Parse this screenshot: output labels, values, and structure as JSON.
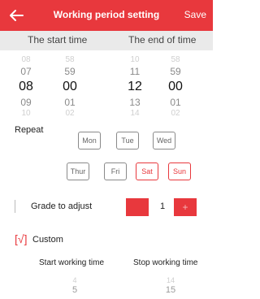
{
  "header": {
    "title": "Working period setting",
    "save_label": "Save"
  },
  "tabs": {
    "start_label": "The start time",
    "end_label": "The end of time"
  },
  "start_time": {
    "hours": [
      "08",
      "07",
      "08",
      "09",
      "10"
    ],
    "minutes": [
      "58",
      "59",
      "00",
      "01",
      "02"
    ]
  },
  "end_time": {
    "hours": [
      "10",
      "11",
      "12",
      "13",
      "14"
    ],
    "minutes": [
      "58",
      "59",
      "00",
      "01",
      "02"
    ]
  },
  "repeat": {
    "label": "Repeat",
    "days": [
      {
        "label": "Mon",
        "selected": false
      },
      {
        "label": "Tue",
        "selected": false
      },
      {
        "label": "Wed",
        "selected": false
      },
      {
        "label": "Thur",
        "selected": false
      },
      {
        "label": "Fri",
        "selected": false
      },
      {
        "label": "Sat",
        "selected": true
      },
      {
        "label": "Sun",
        "selected": true
      }
    ]
  },
  "grade": {
    "label": "Grade to adjust",
    "value": "1",
    "plus_label": "+"
  },
  "custom": {
    "check_label": "[√]",
    "label": "Custom"
  },
  "custom_time": {
    "start_label": "Start working time",
    "stop_label": "Stop working time",
    "start_values": [
      "4",
      "5"
    ],
    "stop_values": [
      "14",
      "15"
    ]
  },
  "colors": {
    "accent": "#e8383d",
    "tab_bg": "#eaeaea"
  }
}
